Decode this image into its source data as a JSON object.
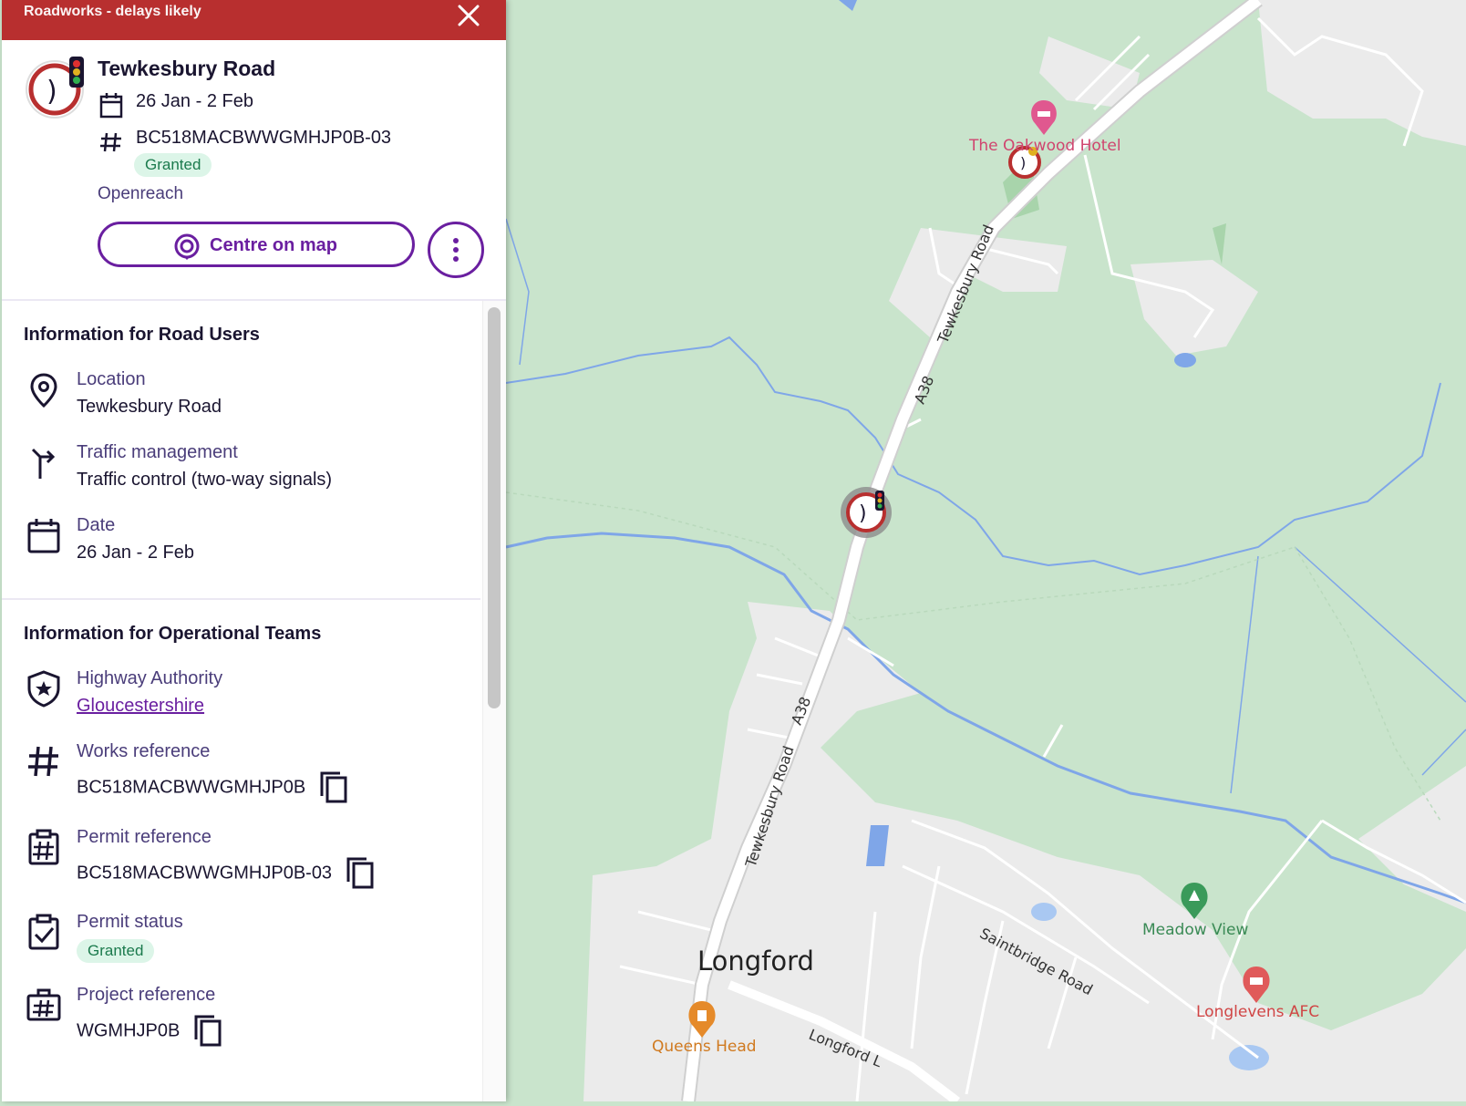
{
  "panel": {
    "header_title": "Roadworks - delays likely",
    "summary": {
      "title": "Tewkesbury Road",
      "date": "26 Jan - 2 Feb",
      "permit_id": "BC518MACBWWGMHJP0B-03",
      "status": "Granted",
      "promoter": "Openreach"
    },
    "centre_button": "Centre on map",
    "road_users": {
      "title": "Information for Road Users",
      "items": [
        {
          "label": "Location",
          "value": "Tewkesbury Road",
          "icon": "location-pin-icon"
        },
        {
          "label": "Traffic management",
          "value": "Traffic control (two-way signals)",
          "icon": "traffic-management-icon"
        },
        {
          "label": "Date",
          "value": "26 Jan - 2 Feb",
          "icon": "calendar-icon"
        }
      ]
    },
    "operational": {
      "title": "Information for Operational Teams",
      "highway_authority": {
        "label": "Highway Authority",
        "value": "Gloucestershire"
      },
      "works_reference": {
        "label": "Works reference",
        "value": "BC518MACBWWGMHJP0B"
      },
      "permit_reference": {
        "label": "Permit reference",
        "value": "BC518MACBWWGMHJP0B-03"
      },
      "permit_status": {
        "label": "Permit status",
        "value": "Granted"
      },
      "project_reference": {
        "label": "Project reference",
        "value": "WGMHJP0B"
      }
    }
  },
  "map": {
    "labels": {
      "hotel": "The Oakwood Hotel",
      "tewkesbury_1": "Tewkesbury Road",
      "tewkesbury_2": "Tewkesbury Road",
      "a38_1": "A38",
      "a38_2": "A38",
      "longford": "Longford",
      "saintbridge": "Saintbridge Road",
      "meadow": "Meadow View",
      "longlevens": "Longlevens AFC",
      "queens": "Queens Head",
      "longford_lane": "Longford L"
    },
    "colors": {
      "green": "#c9e4cc",
      "urban": "#ebebeb",
      "water": "#7fa6e8",
      "accent": "#6a1fa0",
      "alert": "#b82f2f"
    }
  }
}
